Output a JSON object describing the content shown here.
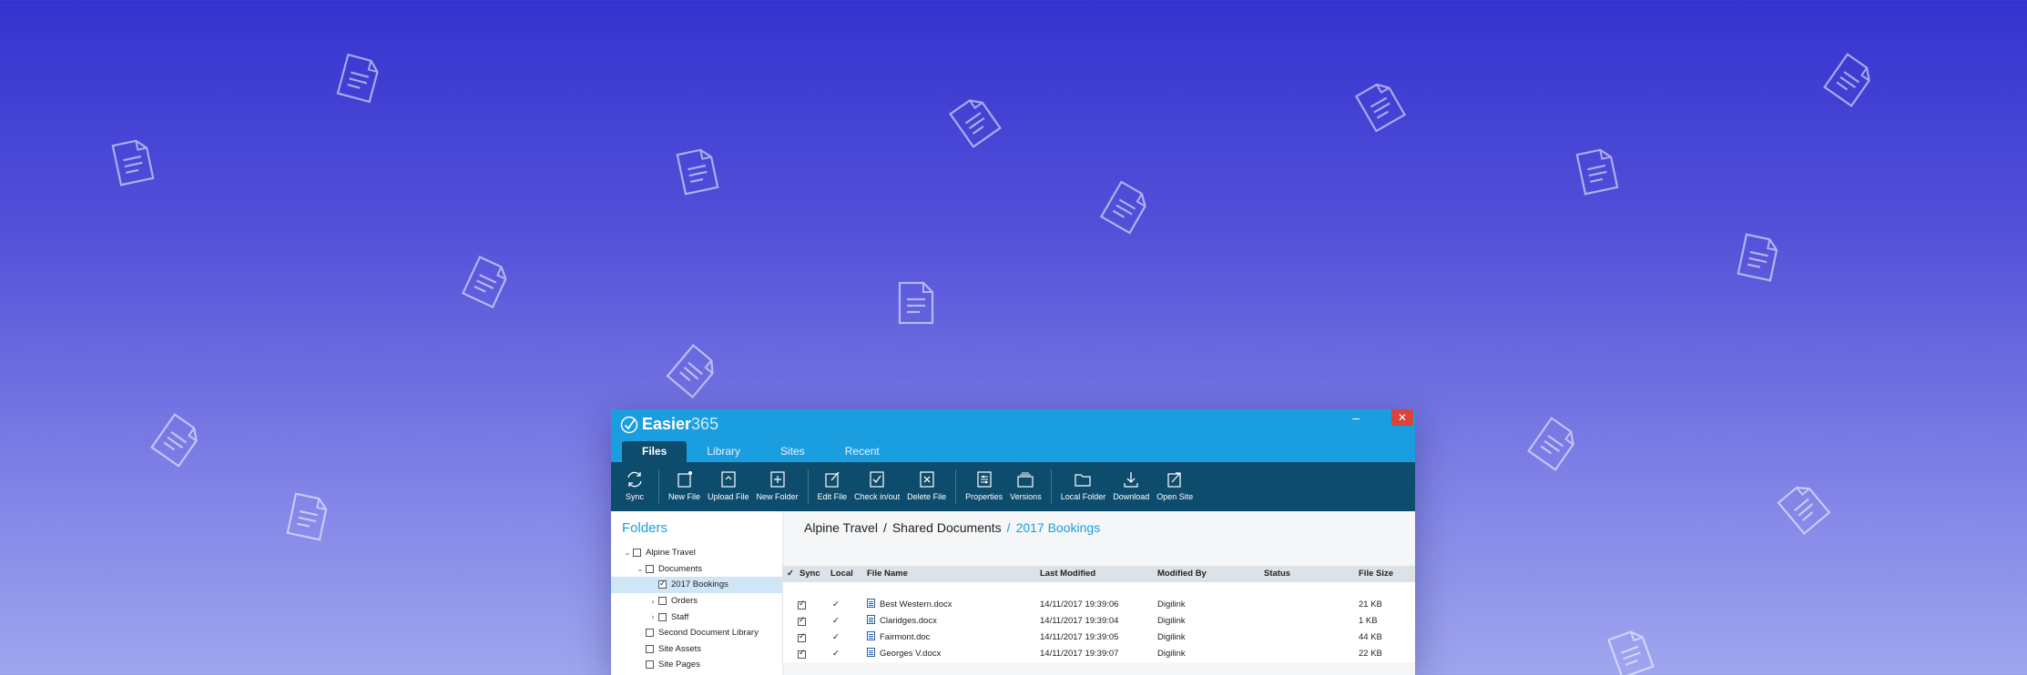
{
  "app": {
    "name_bold": "Easier",
    "name_light": "365",
    "minimize": "–",
    "close": "✕"
  },
  "tabs": [
    {
      "label": "Files",
      "active": true
    },
    {
      "label": "Library"
    },
    {
      "label": "Sites"
    },
    {
      "label": "Recent"
    }
  ],
  "ribbon": {
    "sync": "Sync",
    "new_file": "New File",
    "upload_file": "Upload File",
    "new_folder": "New Folder",
    "edit_file": "Edit File",
    "check_in_out": "Check in/out",
    "delete_file": "Delete File",
    "properties": "Properties",
    "versions": "Versions",
    "local_folder": "Local Folder",
    "download": "Download",
    "open_site": "Open Site"
  },
  "sidebar": {
    "title": "Folders",
    "tree": [
      {
        "label": "Alpine Travel",
        "twisty": "⌄",
        "checked": false
      },
      {
        "label": "Documents",
        "twisty": "⌄",
        "checked": false
      },
      {
        "label": "2017 Bookings",
        "twisty": "",
        "checked": true,
        "selected": true
      },
      {
        "label": "Orders",
        "twisty": "›",
        "checked": false
      },
      {
        "label": "Staff",
        "twisty": "›",
        "checked": false
      },
      {
        "label": "Second Document Library",
        "twisty": "",
        "checked": false
      },
      {
        "label": "Site Assets",
        "twisty": "",
        "checked": false
      },
      {
        "label": "Site Pages",
        "twisty": "",
        "checked": false
      }
    ]
  },
  "breadcrumb": {
    "part1": "Alpine Travel",
    "sep1": "/",
    "part2": "Shared Documents",
    "sep2": "/",
    "current": "2017 Bookings"
  },
  "table": {
    "headers": {
      "check": "✓",
      "sync": "Sync",
      "local": "Local",
      "file_name": "File Name",
      "last_modified": "Last Modified",
      "modified_by": "Modified By",
      "status": "Status",
      "file_size": "File Size"
    },
    "rows": [
      {
        "sync": true,
        "local": "✓",
        "name": "Best Western.docx",
        "modified": "14/11/2017 19:39:06",
        "by": "Digilink",
        "status": "",
        "size": "21 KB"
      },
      {
        "sync": true,
        "local": "✓",
        "name": "Claridges.docx",
        "modified": "14/11/2017 19:39:04",
        "by": "Digilink",
        "status": "",
        "size": "1 KB"
      },
      {
        "sync": true,
        "local": "✓",
        "name": "Fairmont.doc",
        "modified": "14/11/2017 19:39:05",
        "by": "Digilink",
        "status": "",
        "size": "44 KB"
      },
      {
        "sync": true,
        "local": "✓",
        "name": "Georges V.docx",
        "modified": "14/11/2017 19:39:07",
        "by": "Digilink",
        "status": "",
        "size": "22 KB"
      }
    ]
  },
  "colors": {
    "accent": "#1b9ee0",
    "ribbon": "#0e4c6e",
    "close": "#d9443b"
  }
}
